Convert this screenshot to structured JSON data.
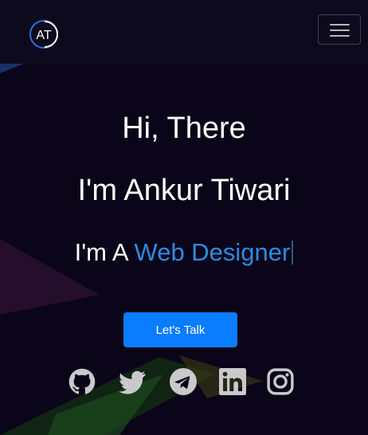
{
  "navbar": {
    "logo_text": "AT",
    "toggler_icon": "hamburger-menu-icon"
  },
  "hero": {
    "greeting": "Hi, There",
    "name_line": "I'm Ankur Tiwari",
    "role_prefix": "I'm A",
    "role_highlight": "Web Designer",
    "cta_label": "Let's Talk"
  },
  "socials": [
    {
      "icon": "github-icon"
    },
    {
      "icon": "twitter-icon"
    },
    {
      "icon": "telegram-icon"
    },
    {
      "icon": "linkedin-icon"
    },
    {
      "icon": "instagram-icon"
    }
  ],
  "colors": {
    "background": "#0b0519",
    "navbar": "#0e0a1d",
    "accent": "#2b8ce3",
    "button": "#0a7cff",
    "icon": "#c9c9cc"
  }
}
